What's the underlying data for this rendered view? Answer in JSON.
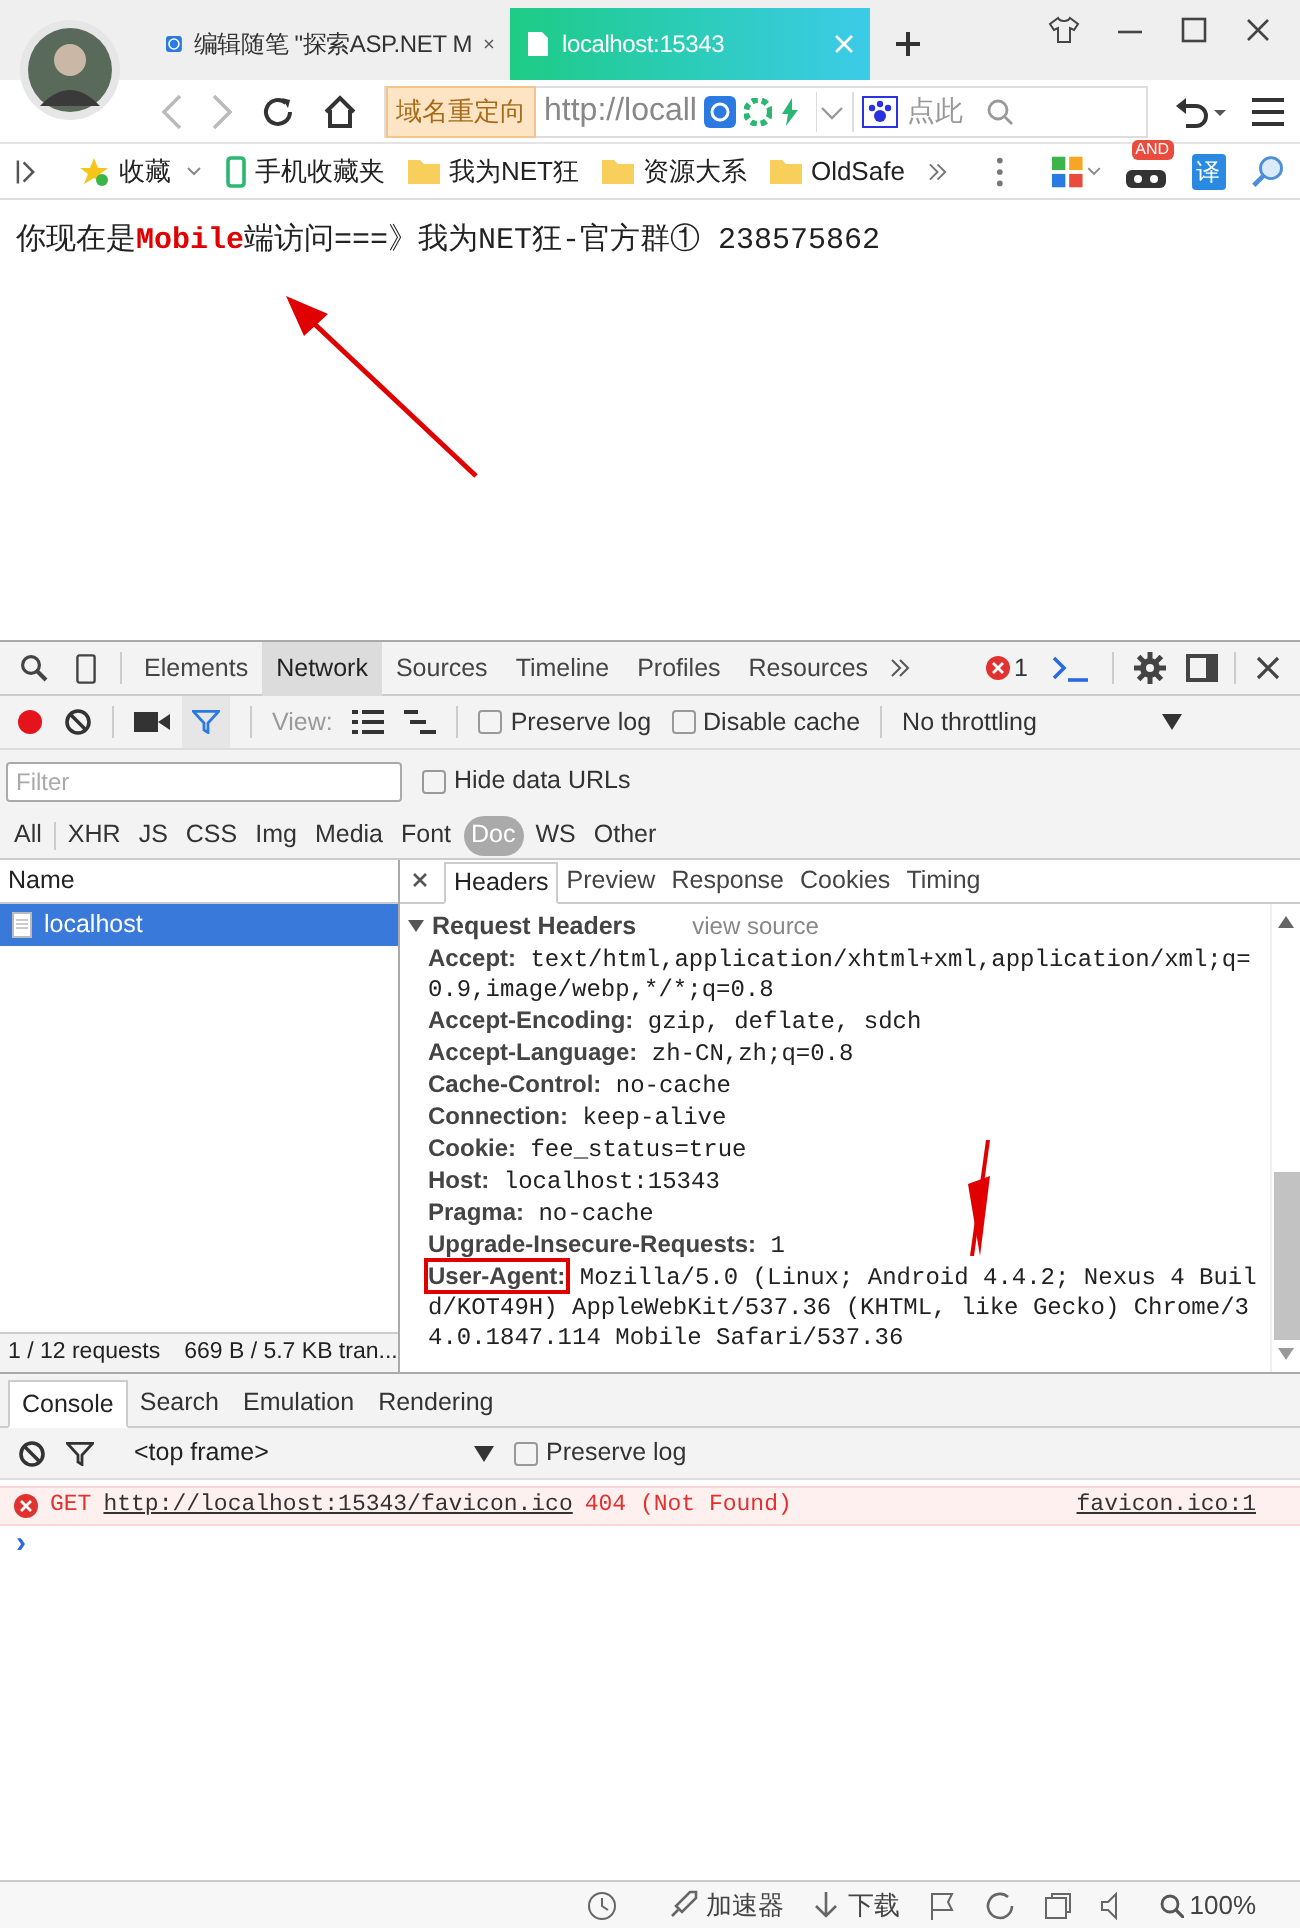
{
  "browser": {
    "tabs": [
      {
        "title": "编辑随笔 \"探索ASP.NET M",
        "selected": false
      },
      {
        "title": "localhost:15343",
        "selected": true
      }
    ],
    "address": {
      "badge": "域名重定向",
      "url": "http://locall",
      "search_placeholder": "点此"
    },
    "bookmarks": [
      {
        "label": "收藏",
        "kind": "star"
      },
      {
        "label": "手机收藏夹",
        "kind": "phone"
      },
      {
        "label": "我为NET狂",
        "kind": "folder"
      },
      {
        "label": "资源大系",
        "kind": "folder"
      },
      {
        "label": "OldSafe",
        "kind": "folder"
      }
    ],
    "ad_badge": "AND",
    "translate": "译"
  },
  "page": {
    "text": "你现在是**Mobile**端访问===》我为NET狂-官方群① 238575862"
  },
  "devtools": {
    "panels": [
      {
        "label": "Elements",
        "selected": false
      },
      {
        "label": "Network",
        "selected": true
      },
      {
        "label": "Sources",
        "selected": false
      },
      {
        "label": "Timeline",
        "selected": false
      },
      {
        "label": "Profiles",
        "selected": false
      },
      {
        "label": "Resources",
        "selected": false
      }
    ],
    "error_count": "1",
    "toolbar": {
      "recording": true,
      "view_label": "View:",
      "preserve_log": {
        "label": "Preserve log",
        "checked": false
      },
      "disable_cache": {
        "label": "Disable cache",
        "checked": false
      },
      "throttling": "No throttling"
    },
    "filter": {
      "placeholder": "Filter",
      "hide_data_urls": {
        "label": "Hide data URLs",
        "checked": false
      }
    },
    "type_filters": [
      {
        "label": "All",
        "selected": false
      },
      {
        "label": "XHR",
        "selected": false
      },
      {
        "label": "JS",
        "selected": false
      },
      {
        "label": "CSS",
        "selected": false
      },
      {
        "label": "Img",
        "selected": false
      },
      {
        "label": "Media",
        "selected": false
      },
      {
        "label": "Font",
        "selected": false
      },
      {
        "label": "Doc",
        "selected": true
      },
      {
        "label": "WS",
        "selected": false
      },
      {
        "label": "Other",
        "selected": false
      }
    ],
    "requests": {
      "column": "Name",
      "rows": [
        {
          "name": "localhost",
          "selected": true
        }
      ],
      "summary": "1 / 12 requests",
      "size": "669 B / 5.7 KB tran..."
    },
    "detail": {
      "tabs": [
        {
          "label": "Headers",
          "selected": true
        },
        {
          "label": "Preview",
          "selected": false
        },
        {
          "label": "Response",
          "selected": false
        },
        {
          "label": "Cookies",
          "selected": false
        },
        {
          "label": "Timing",
          "selected": false
        }
      ],
      "section": "Request Headers",
      "section_link": "view source",
      "expanded": true,
      "headers": [
        {
          "name": "Accept:",
          "value": "text/html,application/xhtml+xml,application/xml;q=0.9,image/webp,*/*;q=0.8",
          "highlighted": false
        },
        {
          "name": "Accept-Encoding:",
          "value": "gzip, deflate, sdch",
          "highlighted": false
        },
        {
          "name": "Accept-Language:",
          "value": "zh-CN,zh;q=0.8",
          "highlighted": false
        },
        {
          "name": "Cache-Control:",
          "value": "no-cache",
          "highlighted": false
        },
        {
          "name": "Connection:",
          "value": "keep-alive",
          "highlighted": false
        },
        {
          "name": "Cookie:",
          "value": "fee_status=true",
          "highlighted": false
        },
        {
          "name": "Host:",
          "value": "localhost:15343",
          "highlighted": false
        },
        {
          "name": "Pragma:",
          "value": "no-cache",
          "highlighted": false
        },
        {
          "name": "Upgrade-Insecure-Requests:",
          "value": "1",
          "highlighted": false
        },
        {
          "name": "User-Agent:",
          "value": "Mozilla/5.0 (Linux; Android 4.4.2; Nexus 4 Build/KOT49H) AppleWebKit/537.36 (KHTML, like Gecko) Chrome/34.0.1847.114 Mobile Safari/537.36",
          "highlighted": true
        }
      ]
    },
    "console": {
      "tabs": [
        {
          "label": "Console",
          "selected": true
        },
        {
          "label": "Search",
          "selected": false
        },
        {
          "label": "Emulation",
          "selected": false
        },
        {
          "label": "Rendering",
          "selected": false
        }
      ],
      "context": "<top frame>",
      "preserve_log": {
        "label": "Preserve log",
        "checked": false
      },
      "messages": [
        {
          "kind": "error",
          "method": "GET",
          "url": "http://localhost:15343/favicon.ico",
          "status": "404 (Not Found)",
          "source": "favicon.ico:1"
        }
      ],
      "prompt": "›"
    }
  },
  "status_bar": {
    "items": [
      {
        "label": "加速器",
        "kind": "rocket"
      },
      {
        "label": "下载",
        "kind": "download"
      }
    ],
    "zoom": "100%"
  }
}
